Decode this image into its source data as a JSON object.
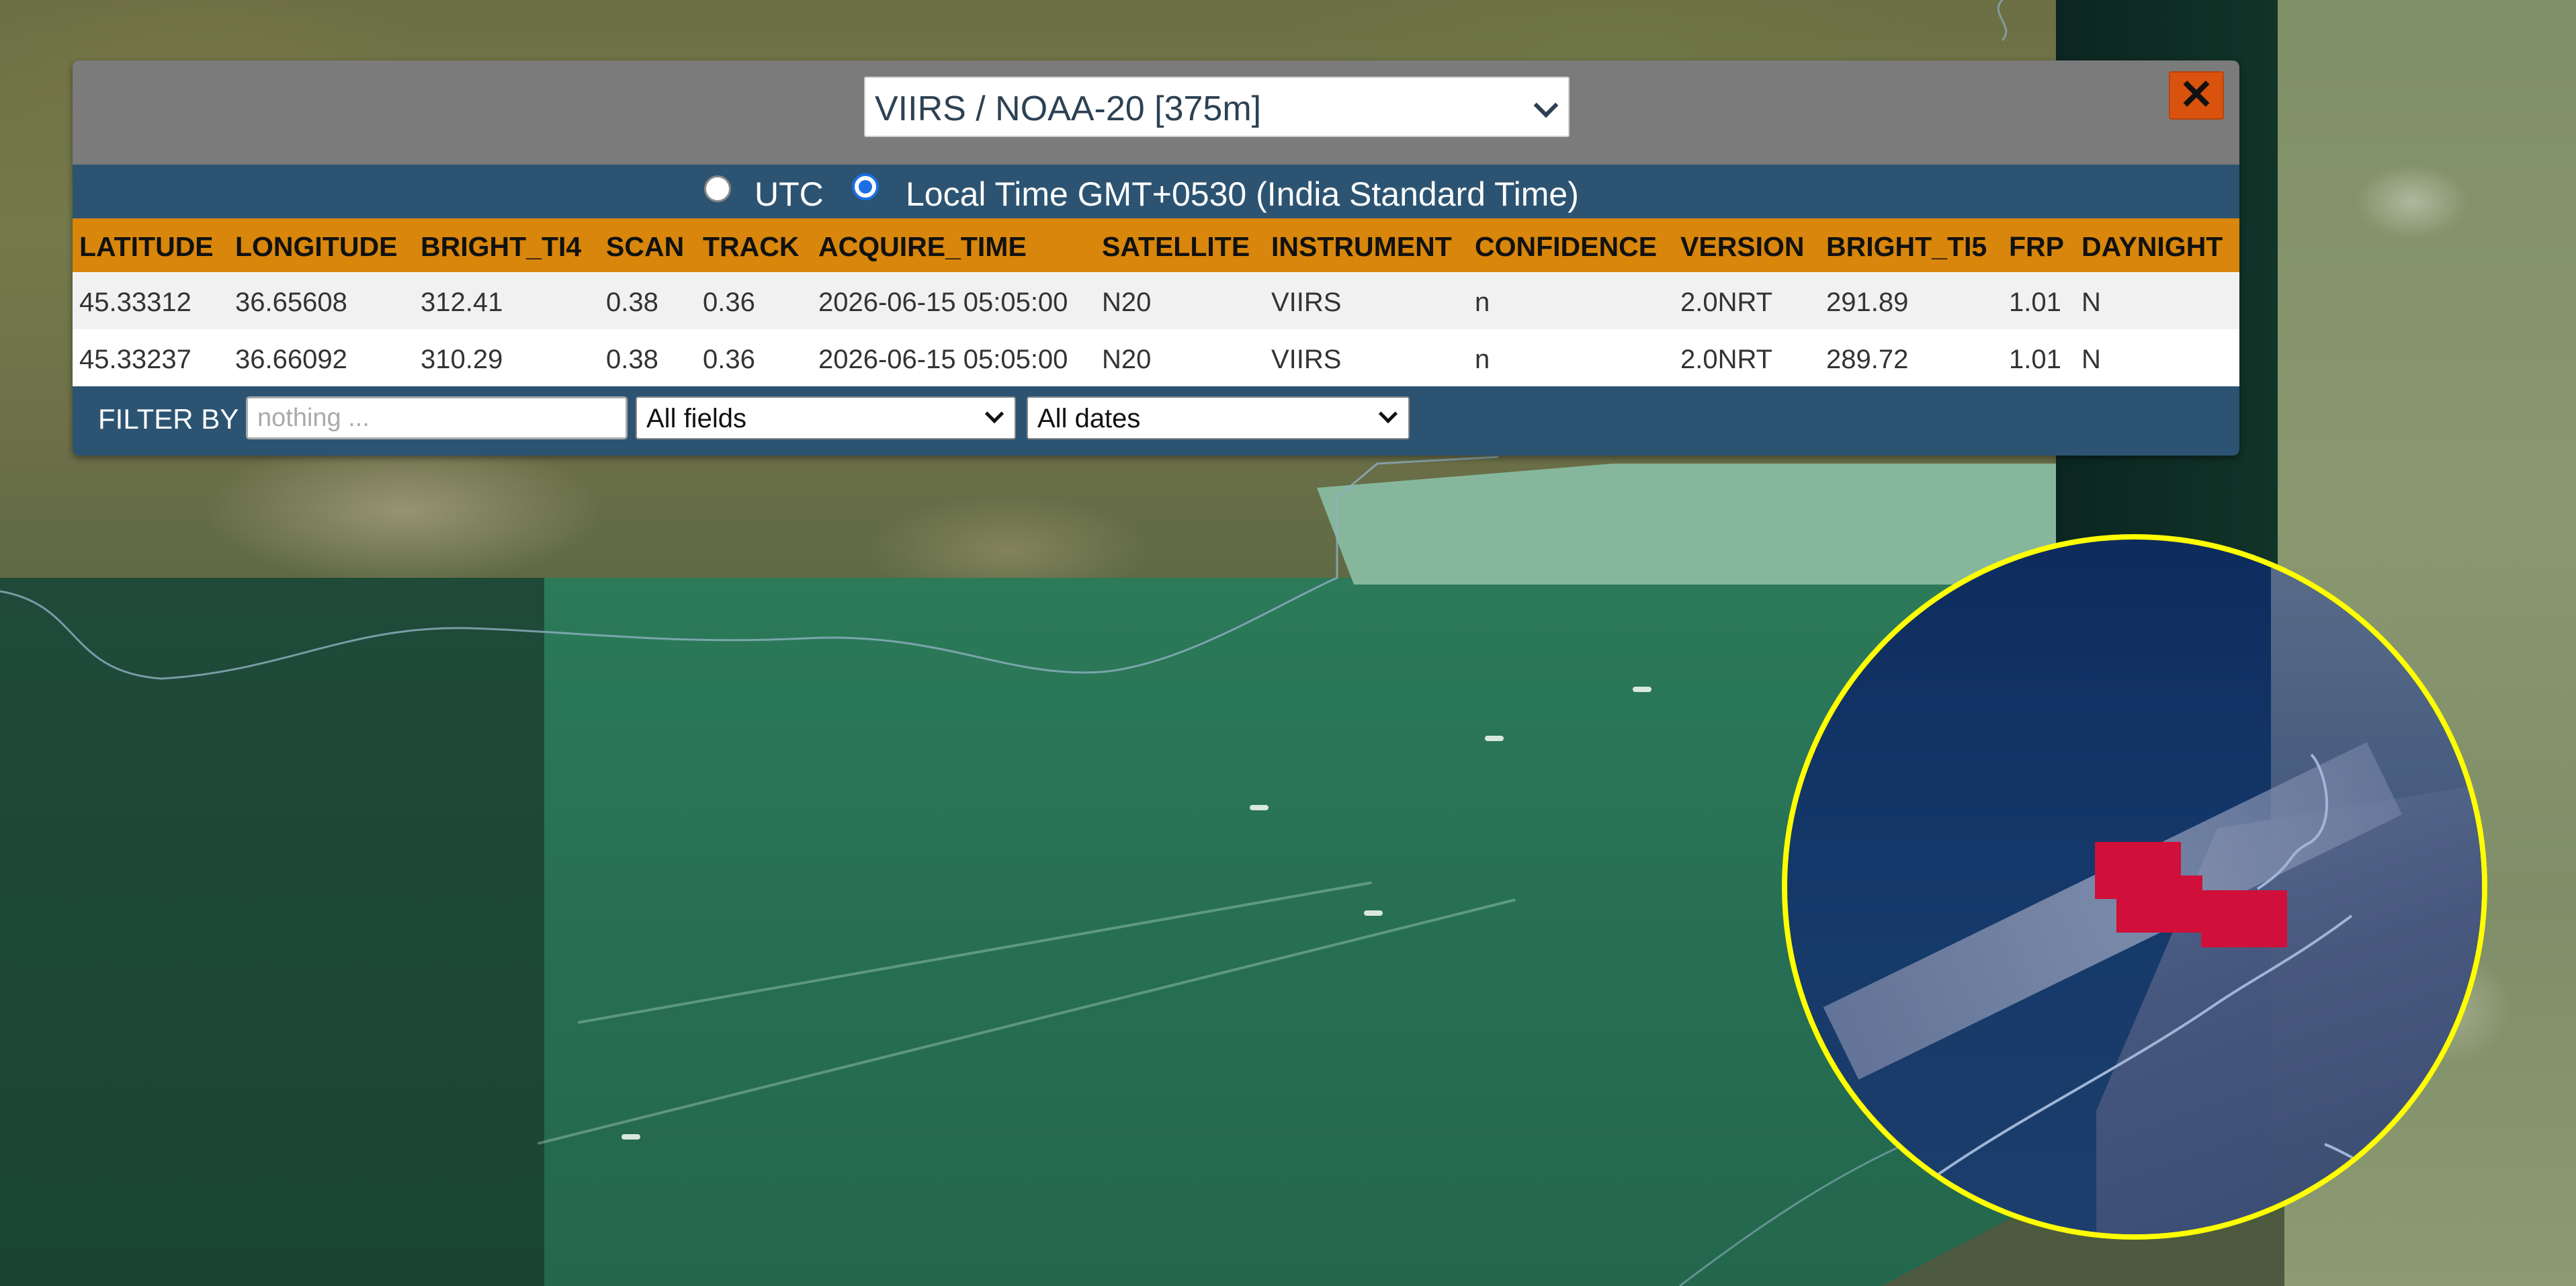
{
  "popup": {
    "satellite_select": {
      "value": "VIIRS / NOAA-20 [375m]",
      "icon": "chevron-down-icon"
    },
    "close_button": {
      "label": "✕",
      "color": "#d9520e"
    },
    "time_mode": {
      "utc_label": "UTC",
      "local_label": "Local Time GMT+0530 (India Standard Time)",
      "selected": "local"
    },
    "table": {
      "columns": [
        "LATITUDE",
        "LONGITUDE",
        "BRIGHT_TI4",
        "SCAN",
        "TRACK",
        "ACQUIRE_TIME",
        "SATELLITE",
        "INSTRUMENT",
        "CONFIDENCE",
        "VERSION",
        "BRIGHT_TI5",
        "FRP",
        "DAYNIGHT"
      ],
      "rows": [
        [
          "45.33312",
          "36.65608",
          "312.41",
          "0.38",
          "0.36",
          "2026-06-15 05:05:00",
          "N20",
          "VIIRS",
          "n",
          "2.0NRT",
          "291.89",
          "1.01",
          "N"
        ],
        [
          "45.33237",
          "36.66092",
          "310.29",
          "0.38",
          "0.36",
          "2026-06-15 05:05:00",
          "N20",
          "VIIRS",
          "n",
          "2.0NRT",
          "289.72",
          "1.01",
          "N"
        ]
      ],
      "header_color": "#d8860c"
    },
    "filter": {
      "label": "FILTER BY",
      "placeholder": "nothing ...",
      "value": "",
      "field_select": "All fields",
      "date_select": "All dates"
    }
  },
  "map": {
    "magnifier_ring_color": "#ffff00",
    "fire_detection_color": "#d0103a"
  }
}
